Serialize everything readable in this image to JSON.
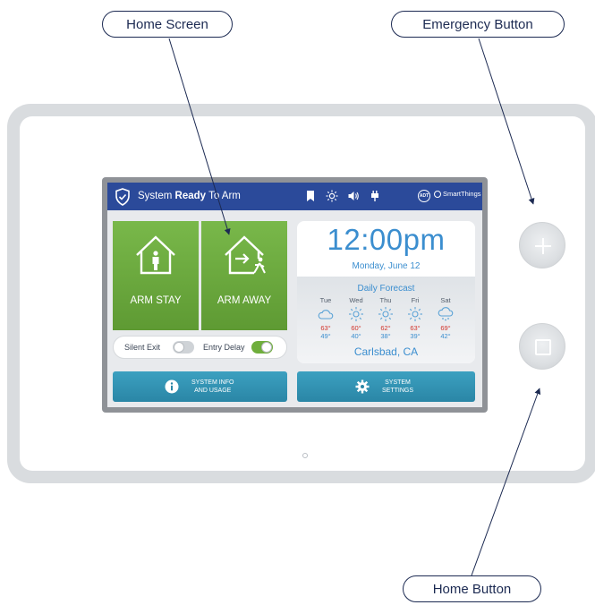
{
  "callouts": {
    "home_screen": "Home Screen",
    "emergency_button": "Emergency Button",
    "home_button": "Home Button"
  },
  "status_bar": {
    "prefix": "System ",
    "state": "Ready",
    "suffix": " To Arm",
    "icons": [
      "bookmark-icon",
      "brightness-icon",
      "volume-icon",
      "power-plug-icon"
    ],
    "brand_adt": "ADT",
    "brand_smartthings": "SmartThings"
  },
  "arm_tiles": {
    "stay_label": "ARM STAY",
    "away_label": "ARM AWAY"
  },
  "toggles": {
    "silent_exit_label": "Silent Exit",
    "silent_exit_on": false,
    "entry_delay_label": "Entry Delay",
    "entry_delay_on": true
  },
  "clock": {
    "time": "12:00pm",
    "date": "Monday, June 12"
  },
  "forecast": {
    "title": "Daily Forecast",
    "days": [
      {
        "day": "Tue",
        "icon": "cloudy-icon",
        "high": "63°",
        "low": "49°"
      },
      {
        "day": "Wed",
        "icon": "sunny-icon",
        "high": "60°",
        "low": "40°"
      },
      {
        "day": "Thu",
        "icon": "sunny-icon",
        "high": "62°",
        "low": "38°"
      },
      {
        "day": "Fri",
        "icon": "sunny-icon",
        "high": "63°",
        "low": "39°"
      },
      {
        "day": "Sat",
        "icon": "rain-icon",
        "high": "69°",
        "low": "42°"
      }
    ],
    "city": "Carlsbad, CA"
  },
  "buttons": {
    "info_line1": "SYSTEM INFO",
    "info_line2": "AND USAGE",
    "settings_line1": "SYSTEM",
    "settings_line2": "SETTINGS"
  },
  "colors": {
    "status_bar": "#2b4a9a",
    "arm_green": "#6aa93b",
    "accent_blue": "#3b8ecf",
    "action_teal": "#2f92b3",
    "high_temp_red": "#d2342b"
  }
}
